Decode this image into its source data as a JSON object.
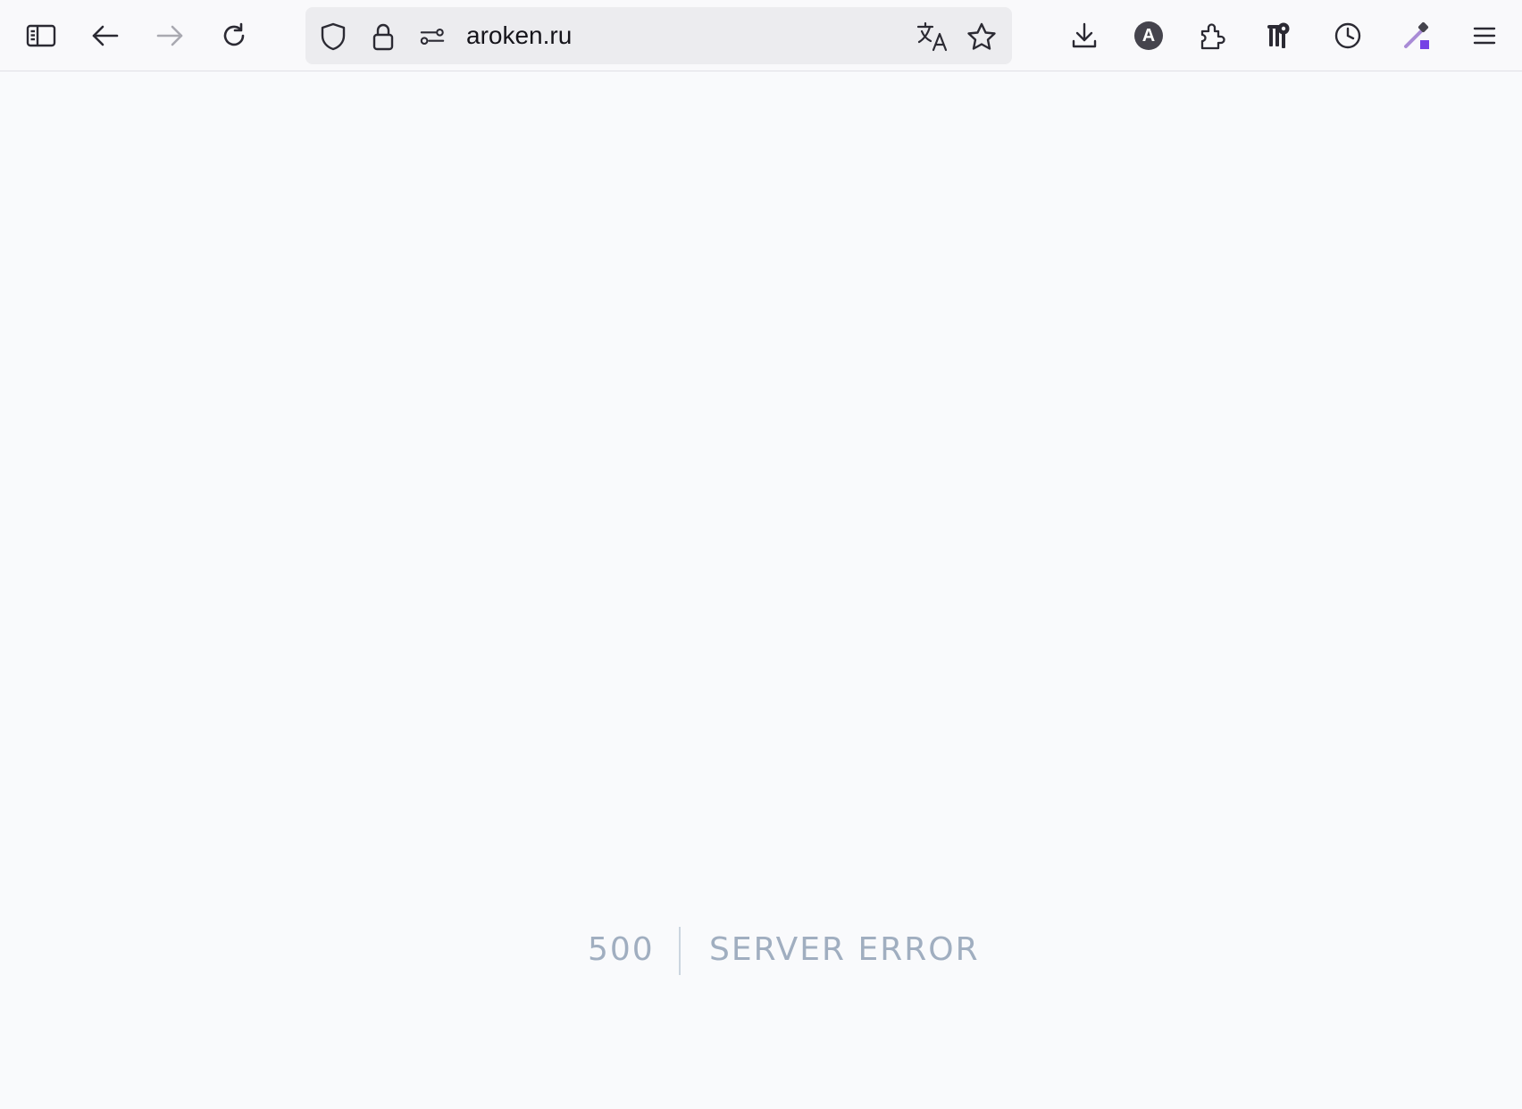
{
  "browser": {
    "url": "aroken.ru",
    "toolbar_icons": [
      "sidebar-icon",
      "back-icon",
      "forward-icon",
      "reload-icon",
      "shield-icon",
      "lock-icon",
      "permissions-icon",
      "translate-icon",
      "bookmark-star-icon",
      "download-icon",
      "account-icon",
      "extensions-icon",
      "keys-icon",
      "history-icon",
      "eyedropper-icon",
      "menu-icon"
    ],
    "account_letter": "A"
  },
  "page": {
    "error_code": "500",
    "error_message": "SERVER ERROR"
  },
  "colors": {
    "page_background": "#f9fafc",
    "error_text": "#a0aec0",
    "divider": "#cbd5e0",
    "accent_purple": "#7542e5"
  }
}
